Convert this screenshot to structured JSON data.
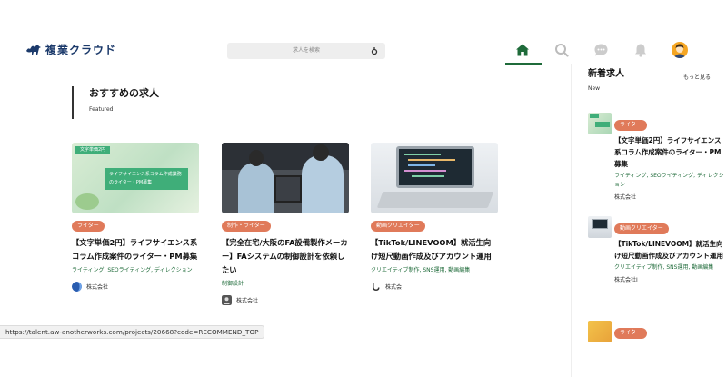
{
  "header": {
    "logo_text": "複業クラウド",
    "search_placeholder": "求人を検索",
    "nav_icons": [
      "home-icon",
      "search-icon",
      "chat-icon",
      "bell-icon",
      "avatar"
    ]
  },
  "featured": {
    "title": "おすすめの求人",
    "subtitle": "Featured",
    "cards": [
      {
        "img_label": "文字単価2円",
        "img_text": "ライフサイエンス系コラム作成業務のライター・PM募集",
        "tag": "ライター",
        "title": "【文字単価2円】ライフサイエンス系コラム作成案件のライター・PM募集",
        "categories": "ライティング, SEOライティング, ディレクション",
        "company": "株式会社"
      },
      {
        "tag": "制作・ライター",
        "title": "【完全在宅/大阪のFA設備製作メーカー】FAシステムの制御設計を依頼したい",
        "categories": "制御設計",
        "company": "株式会社"
      },
      {
        "tag": "動画クリエイター",
        "title": "【TikTok/LINEVOOM】就活生向け短尺動画作成及びアカウント運用",
        "categories": "クリエイティブ制作, SNS運用, 動画編集",
        "company": "株式会"
      }
    ]
  },
  "new_jobs": {
    "title": "新着求人",
    "subtitle": "New",
    "more_label": "もっと見る",
    "items": [
      {
        "tag": "ライター",
        "title": "【文字単価2円】ライフサイエンス系コラム作成案件のライター・PM募集",
        "categories": "ライティング, SEOライティング, ディレクション",
        "company": "株式会社"
      },
      {
        "tag": "動画クリエイター",
        "title": "【TikTok/LINEVOOM】就活生向け短尺動画作成及びアカウント運用",
        "categories": "クリエイティブ制作, SNS運用, 動画編集",
        "company": "株式会社I"
      },
      {
        "tag": "ライター"
      }
    ]
  },
  "statusbar": {
    "url": "https://talent.aw-anotherworks.com/projects/20668?code=RECOMMEND_TOP"
  },
  "colors": {
    "accent_green": "#1f6b3a",
    "tag_orange": "#e07a5a",
    "logo_navy": "#1c3a6b"
  }
}
